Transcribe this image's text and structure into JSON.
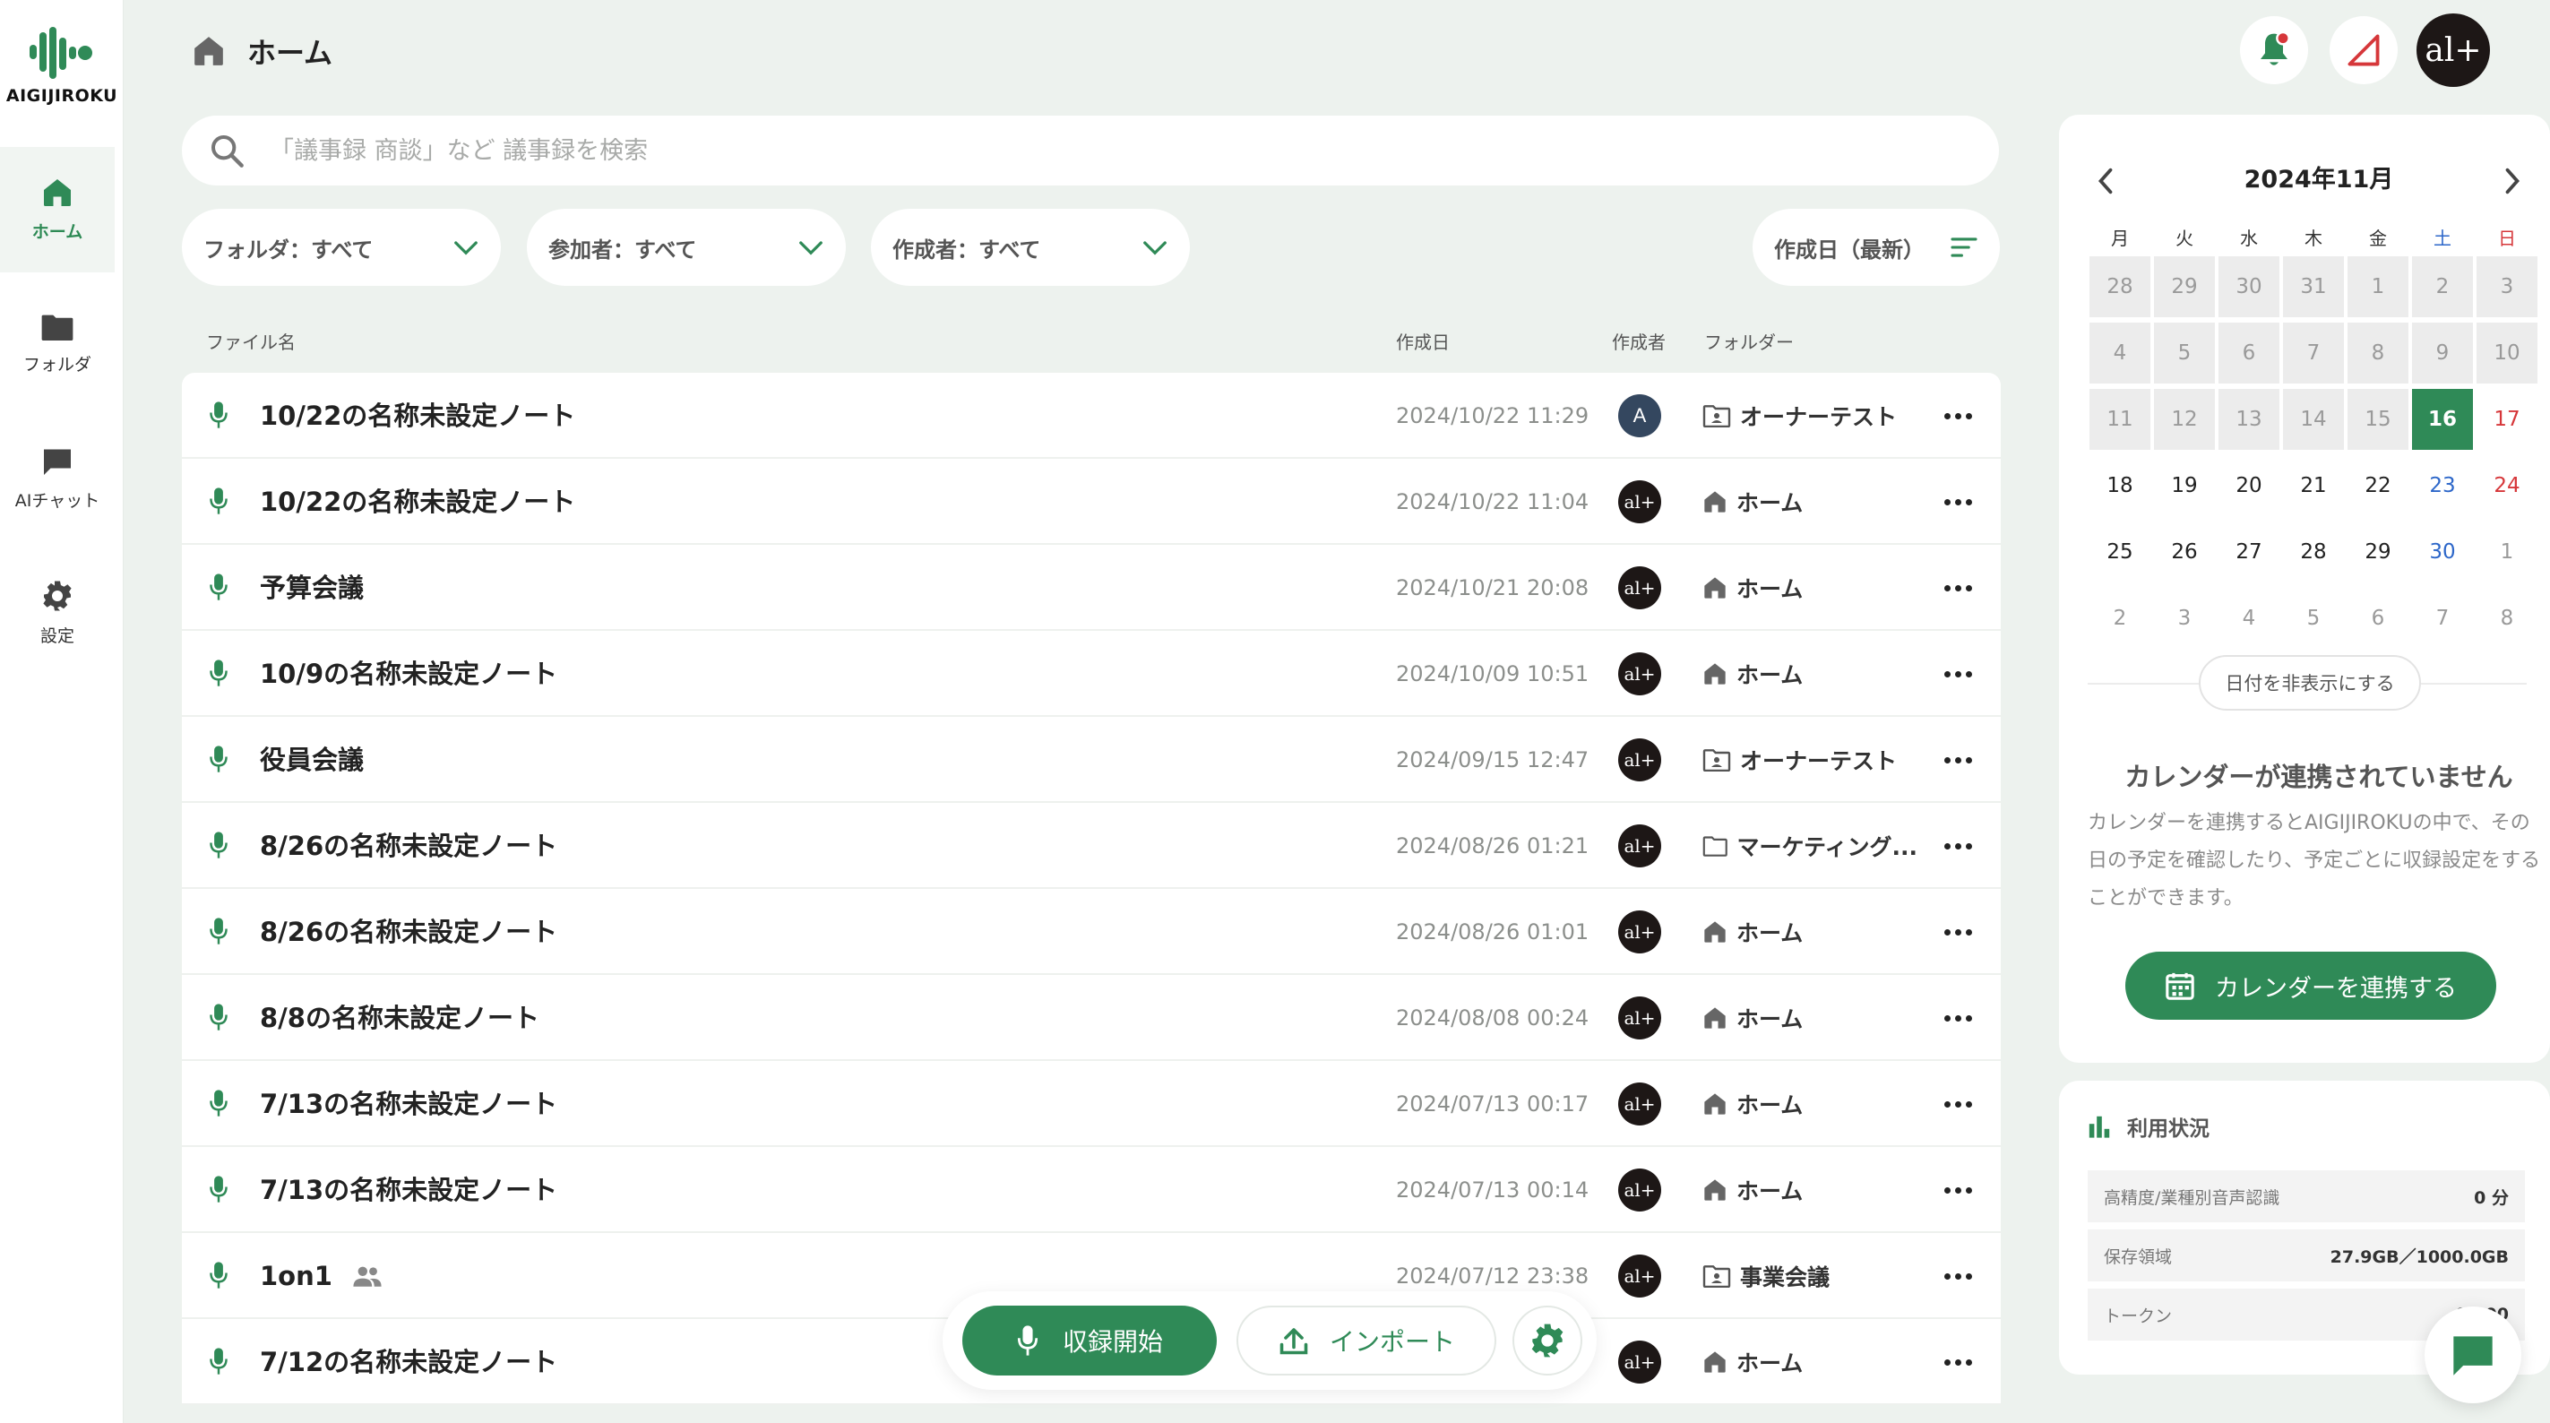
{
  "app": {
    "brand": "AIGIJIROKU"
  },
  "sidebar": {
    "items": [
      {
        "label": "ホーム",
        "icon": "home-icon"
      },
      {
        "label": "フォルダ",
        "icon": "folder-icon"
      },
      {
        "label": "AIチャット",
        "icon": "chat-icon"
      },
      {
        "label": "設定",
        "icon": "gear-icon"
      }
    ]
  },
  "header": {
    "title": "ホーム",
    "avatar_text": "al+"
  },
  "search": {
    "placeholder": "「議事録 商談」など 議事録を検索"
  },
  "filters": {
    "folder": "フォルダ：すべて",
    "participants": "参加者：すべて",
    "creator": "作成者：すべて",
    "sort": "作成日（最新）"
  },
  "table": {
    "columns": {
      "name": "ファイル名",
      "date": "作成日",
      "author": "作成者",
      "folder": "フォルダー"
    },
    "rows": [
      {
        "name": "10/22の名称未設定ノート",
        "date": "2024/10/22 11:29",
        "author": "A",
        "folder": "オーナーテスト",
        "folder_icon": "shared-folder-icon"
      },
      {
        "name": "10/22の名称未設定ノート",
        "date": "2024/10/22 11:04",
        "author": "al+",
        "folder": "ホーム",
        "folder_icon": "home-icon"
      },
      {
        "name": "予算会議",
        "date": "2024/10/21 20:08",
        "author": "al+",
        "folder": "ホーム",
        "folder_icon": "home-icon"
      },
      {
        "name": "10/9の名称未設定ノート",
        "date": "2024/10/09 10:51",
        "author": "al+",
        "folder": "ホーム",
        "folder_icon": "home-icon"
      },
      {
        "name": "役員会議",
        "date": "2024/09/15 12:47",
        "author": "al+",
        "folder": "オーナーテスト",
        "folder_icon": "shared-folder-icon"
      },
      {
        "name": "8/26の名称未設定ノート",
        "date": "2024/08/26 01:21",
        "author": "al+",
        "folder": "マーケティング...",
        "folder_icon": "folder-icon"
      },
      {
        "name": "8/26の名称未設定ノート",
        "date": "2024/08/26 01:01",
        "author": "al+",
        "folder": "ホーム",
        "folder_icon": "home-icon"
      },
      {
        "name": "8/8の名称未設定ノート",
        "date": "2024/08/08 00:24",
        "author": "al+",
        "folder": "ホーム",
        "folder_icon": "home-icon"
      },
      {
        "name": "7/13の名称未設定ノート",
        "date": "2024/07/13 00:17",
        "author": "al+",
        "folder": "ホーム",
        "folder_icon": "home-icon"
      },
      {
        "name": "7/13の名称未設定ノート",
        "date": "2024/07/13 00:14",
        "author": "al+",
        "folder": "ホーム",
        "folder_icon": "home-icon"
      },
      {
        "name": "1on1",
        "date": "2024/07/12 23:38",
        "author": "al+",
        "folder": "事業会議",
        "folder_icon": "shared-folder-icon",
        "shared": true
      },
      {
        "name": "7/12の名称未設定ノート",
        "date": "",
        "author": "al+",
        "folder": "ホーム",
        "folder_icon": "home-icon"
      }
    ]
  },
  "actions": {
    "record": "収録開始",
    "import": "インポート"
  },
  "calendar": {
    "title": "2024年11月",
    "weekdays": [
      "月",
      "火",
      "水",
      "木",
      "金",
      "土",
      "日"
    ],
    "days": [
      {
        "d": "28",
        "s": "past"
      },
      {
        "d": "29",
        "s": "past"
      },
      {
        "d": "30",
        "s": "past"
      },
      {
        "d": "31",
        "s": "past"
      },
      {
        "d": "1",
        "s": "past"
      },
      {
        "d": "2",
        "s": "past"
      },
      {
        "d": "3",
        "s": "past"
      },
      {
        "d": "4",
        "s": "past"
      },
      {
        "d": "5",
        "s": "past"
      },
      {
        "d": "6",
        "s": "past"
      },
      {
        "d": "7",
        "s": "past"
      },
      {
        "d": "8",
        "s": "past"
      },
      {
        "d": "9",
        "s": "past"
      },
      {
        "d": "10",
        "s": "past"
      },
      {
        "d": "11",
        "s": "past"
      },
      {
        "d": "12",
        "s": "past"
      },
      {
        "d": "13",
        "s": "past"
      },
      {
        "d": "14",
        "s": "past"
      },
      {
        "d": "15",
        "s": "past"
      },
      {
        "d": "16",
        "s": "today"
      },
      {
        "d": "17",
        "s": "sun"
      },
      {
        "d": "18",
        "s": ""
      },
      {
        "d": "19",
        "s": ""
      },
      {
        "d": "20",
        "s": ""
      },
      {
        "d": "21",
        "s": ""
      },
      {
        "d": "22",
        "s": ""
      },
      {
        "d": "23",
        "s": "sat"
      },
      {
        "d": "24",
        "s": "sun"
      },
      {
        "d": "25",
        "s": ""
      },
      {
        "d": "26",
        "s": ""
      },
      {
        "d": "27",
        "s": ""
      },
      {
        "d": "28",
        "s": ""
      },
      {
        "d": "29",
        "s": ""
      },
      {
        "d": "30",
        "s": "sat"
      },
      {
        "d": "1",
        "s": "other"
      },
      {
        "d": "2",
        "s": "other"
      },
      {
        "d": "3",
        "s": "other"
      },
      {
        "d": "4",
        "s": "other"
      },
      {
        "d": "5",
        "s": "other"
      },
      {
        "d": "6",
        "s": "other"
      },
      {
        "d": "7",
        "s": "other"
      },
      {
        "d": "8",
        "s": "other"
      }
    ],
    "hide_dates": "日付を非表示にする",
    "not_connected_title": "カレンダーが連携されていません",
    "not_connected_body": "カレンダーを連携するとAIGIJIROKUの中で、その日の予定を確認したり、予定ごとに収録設定をすることができます。",
    "connect_button": "カレンダーを連携する"
  },
  "usage": {
    "title": "利用状況",
    "rows": [
      {
        "label": "高精度/業種別音声認識",
        "value": "0 分"
      },
      {
        "label": "保存領域",
        "value": "27.9GB／1000.0GB"
      },
      {
        "label": "トークン",
        "value": "0 / 00"
      }
    ]
  },
  "colors": {
    "accent": "#2f8a57",
    "sidebar_bg": "#ffffff",
    "page_bg": "#edf2ee",
    "saturday": "#2d67c9",
    "sunday": "#d6373a",
    "notification_dot": "#d6373a"
  }
}
